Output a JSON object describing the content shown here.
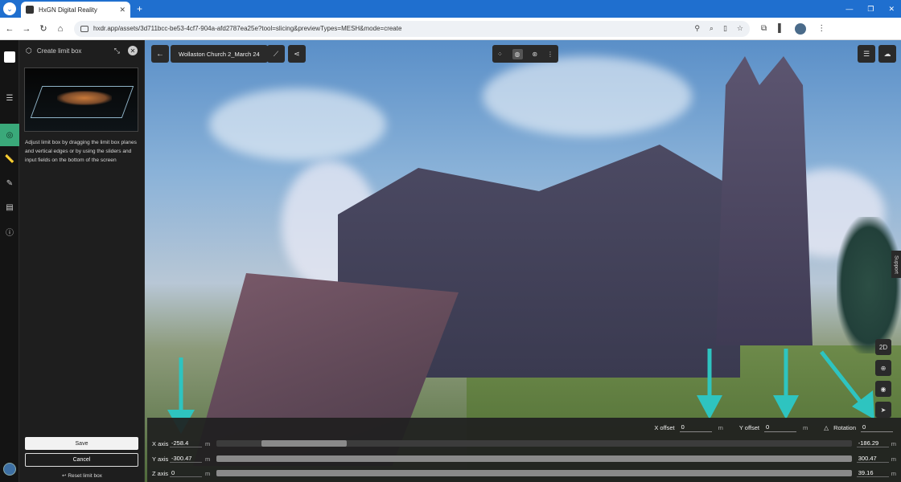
{
  "browser": {
    "tab_title": "HxGN Digital Reality",
    "url": "hxdr.app/assets/3d711bcc-be53-4cf7-904a-afd2787ea25e?tool=slicing&previewTypes=MESH&mode=create"
  },
  "panel": {
    "title": "Create limit box",
    "description": "Adjust limit box by dragging the limit box planes and vertical edges or by using the sliders and input fields on the bottom of the screen",
    "save_label": "Save",
    "cancel_label": "Cancel",
    "reset_label": "Reset limit box"
  },
  "viewport": {
    "asset_title": "Wollaston Church 2_March 24",
    "support_label": "Support",
    "view_mode_label": "2D",
    "sky_color": "#7aa6d4",
    "accent_arrow_color": "#2ec4c0"
  },
  "limit_box": {
    "x_offset_label": "X offset",
    "x_offset_value": "0",
    "y_offset_label": "Y offset",
    "y_offset_value": "0",
    "rotation_label": "Rotation",
    "rotation_value": "0",
    "unit": "m",
    "axes": [
      {
        "label": "X axis",
        "min": "-258.4",
        "max": "-186.29",
        "range_start": 0.07,
        "range_end": 0.205
      },
      {
        "label": "Y axis",
        "min": "-300.47",
        "max": "300.47",
        "range_start": 0.0,
        "range_end": 1.0
      },
      {
        "label": "Z axis",
        "min": "0",
        "max": "39.16",
        "range_start": 0.0,
        "range_end": 1.0
      }
    ]
  }
}
